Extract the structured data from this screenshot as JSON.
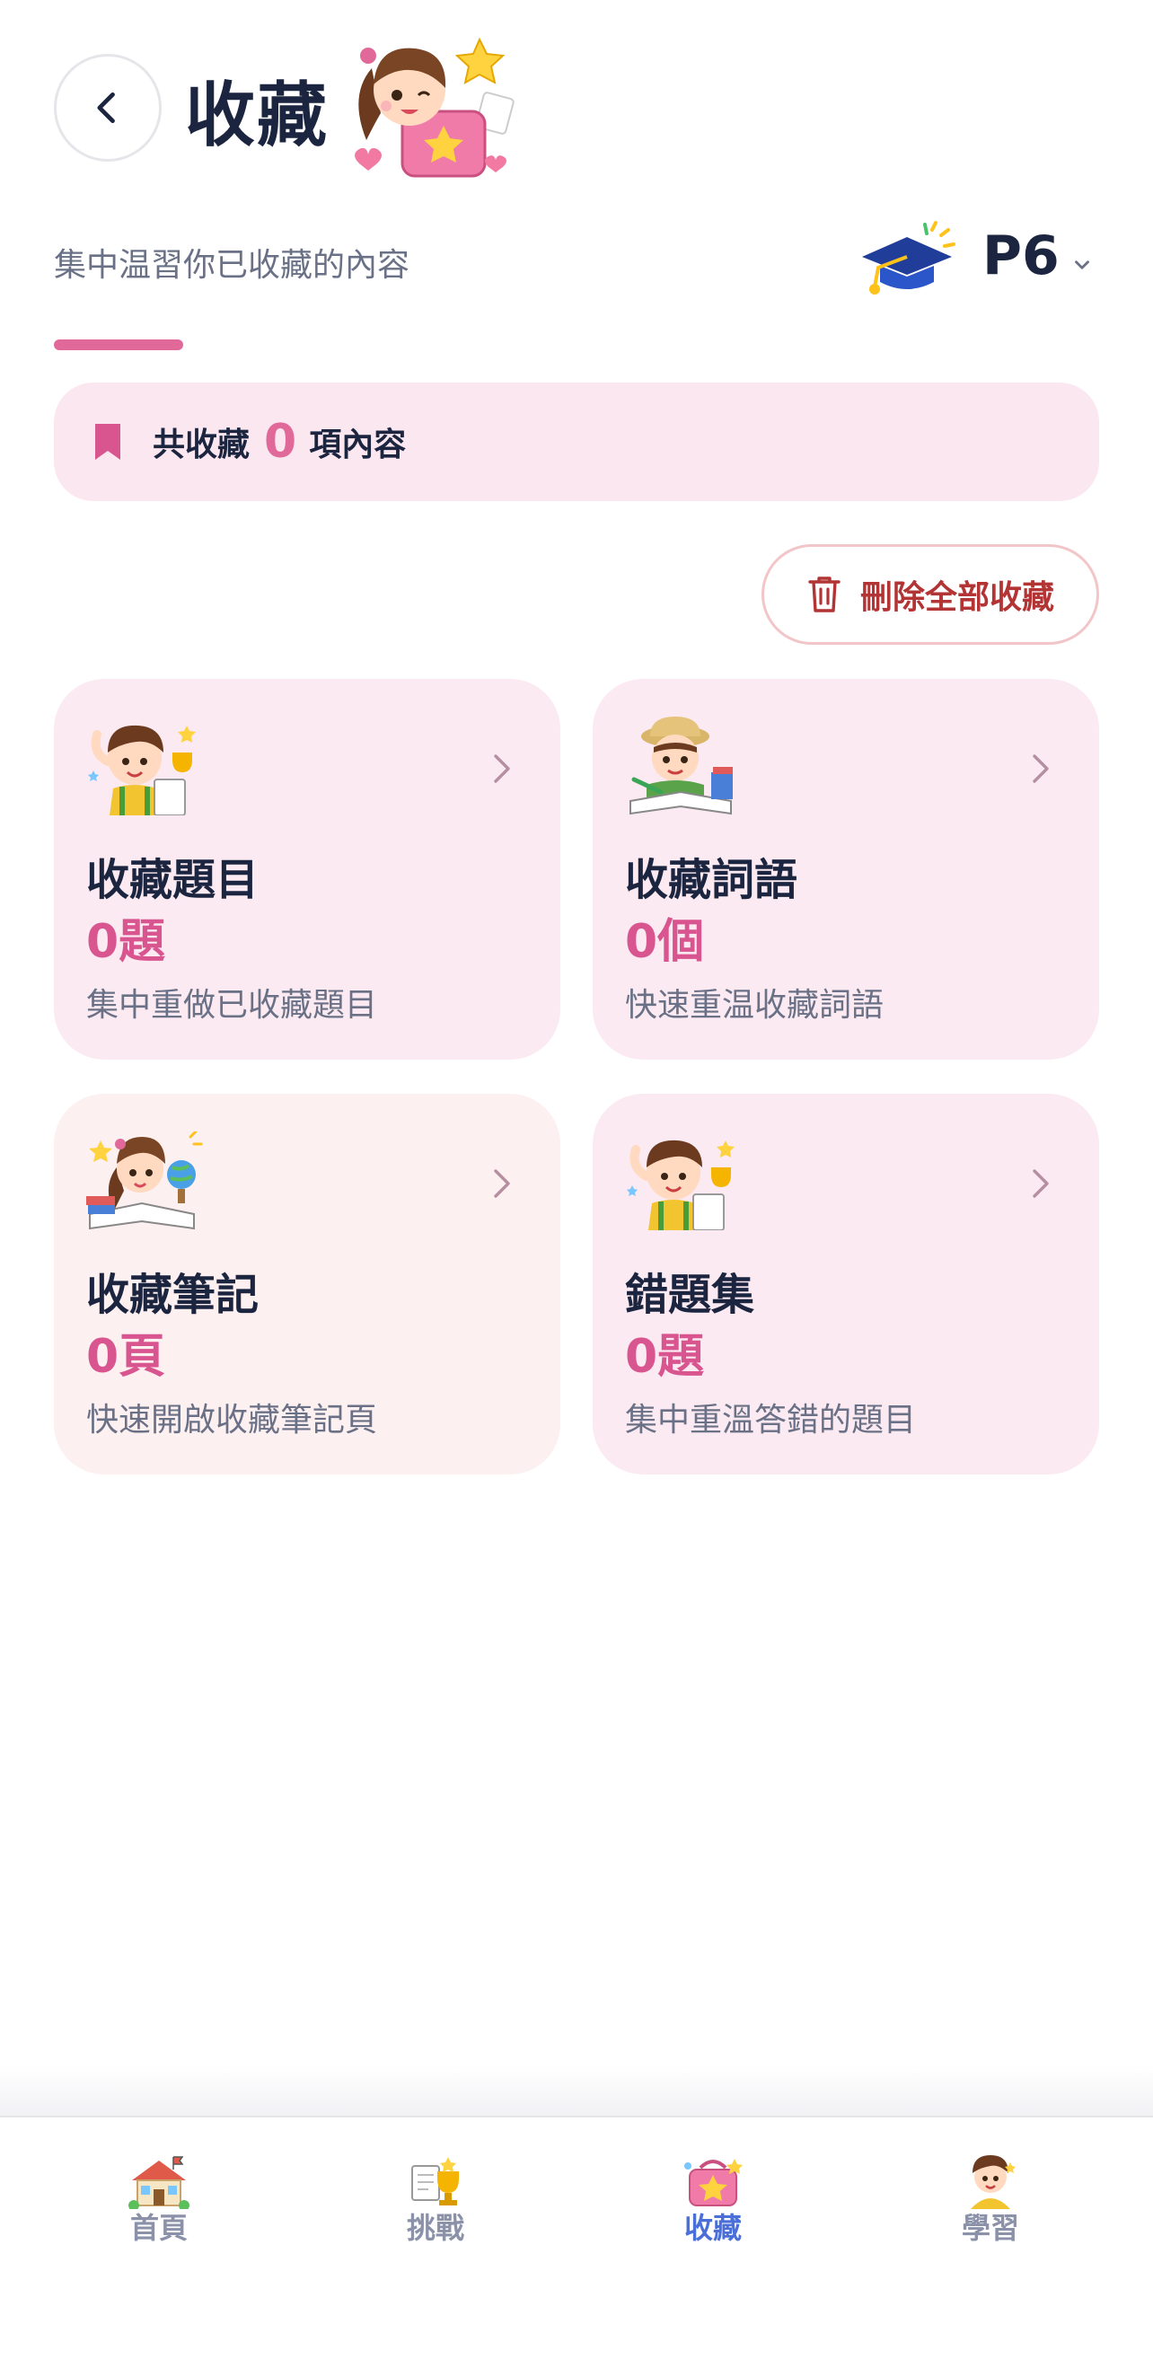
{
  "header": {
    "title": "收藏",
    "subtitle": "集中温習你已收藏的內容",
    "grade": "P6"
  },
  "summary": {
    "prefix": "共收藏",
    "count": "0",
    "suffix": "項內容"
  },
  "actions": {
    "delete_all_label": "刪除全部收藏"
  },
  "cards": [
    {
      "title": "收藏題目",
      "count": "0題",
      "description": "集中重做已收藏題目"
    },
    {
      "title": "收藏詞語",
      "count": "0個",
      "description": "快速重温收藏詞語"
    },
    {
      "title": "收藏筆記",
      "count": "0頁",
      "description": "快速開啟收藏筆記頁"
    },
    {
      "title": "錯題集",
      "count": "0題",
      "description": "集中重溫答錯的題目"
    }
  ],
  "bottom_nav": [
    {
      "label": "首頁",
      "icon": "house-icon"
    },
    {
      "label": "挑戰",
      "icon": "trophy-icon"
    },
    {
      "label": "收藏",
      "icon": "bookmark-box-icon",
      "active": true
    },
    {
      "label": "學習",
      "icon": "student-icon"
    }
  ],
  "colors": {
    "accent_pink": "#e0699a",
    "card_bg": "#fbeaf1",
    "card_bg_peach": "#fdf0f0",
    "delete_red": "#b23434",
    "nav_active": "#4a6fd8",
    "nav_inactive": "#8a91a8"
  }
}
